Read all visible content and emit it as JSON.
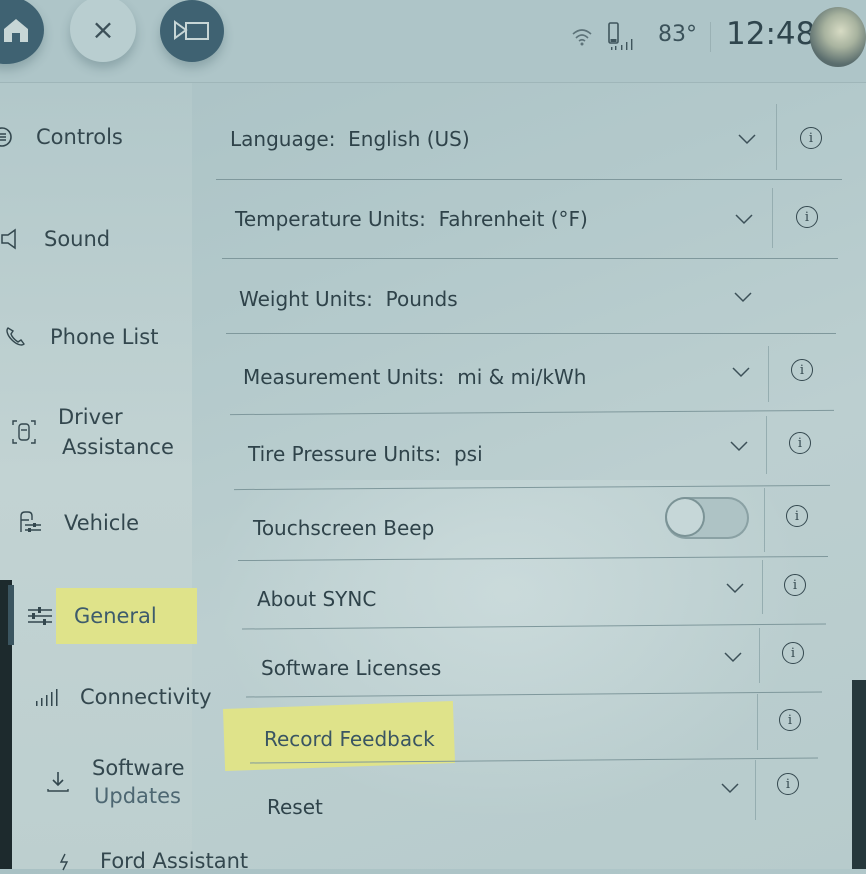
{
  "topbar": {
    "home_icon": "home-icon",
    "close_icon": "close-icon",
    "close_glyph": "×",
    "camera_icon": "video-camera-icon",
    "wifi_icon": "wifi-icon",
    "phone_signal_icon": "phone-signal-icon",
    "temperature": "83°",
    "time": "12:48",
    "avatar": "user-avatar"
  },
  "sidebar": {
    "items": [
      {
        "label": "Controls",
        "icon": "controls-icon"
      },
      {
        "label": "Sound",
        "icon": "speaker-icon"
      },
      {
        "label": "Phone List",
        "icon": "phone-icon"
      },
      {
        "label": "Driver\nAssistance",
        "label_line1": "Driver",
        "label_line2": "Assistance",
        "icon": "driver-assistance-icon"
      },
      {
        "label": "Vehicle",
        "icon": "vehicle-settings-icon"
      },
      {
        "label": "General",
        "icon": "sliders-icon",
        "selected": true,
        "highlighted": true
      },
      {
        "label": "Connectivity",
        "icon": "signal-bars-icon"
      },
      {
        "label": "Software Updates",
        "label_line1": "Software",
        "label_line2": "Updates",
        "icon": "download-icon"
      },
      {
        "label": "Ford Assistant",
        "icon": "ford-assistant-icon"
      }
    ]
  },
  "settings": [
    {
      "label": "Language:  English (US)",
      "dropdown": true,
      "info": true
    },
    {
      "label": "Temperature Units:  Fahrenheit (°F)",
      "dropdown": true,
      "info": true
    },
    {
      "label": "Weight Units:  Pounds",
      "dropdown": true,
      "info": false
    },
    {
      "label": "Measurement Units:  mi & mi/kWh",
      "dropdown": true,
      "info": true
    },
    {
      "label": "Tire Pressure Units:  psi",
      "dropdown": true,
      "info": true
    },
    {
      "label": "Touchscreen Beep",
      "toggle": true,
      "toggle_state": "off",
      "info": true
    },
    {
      "label": "About SYNC",
      "dropdown": true,
      "info": true
    },
    {
      "label": "Software Licenses",
      "dropdown": true,
      "info": true
    },
    {
      "label": "Record Feedback",
      "dropdown": false,
      "info": true,
      "highlighted": true
    },
    {
      "label": "Reset",
      "dropdown": true,
      "info": true
    }
  ],
  "colors": {
    "highlight": "#dfe38a",
    "dark_button": "#3f6272",
    "text": "#2f434a"
  }
}
